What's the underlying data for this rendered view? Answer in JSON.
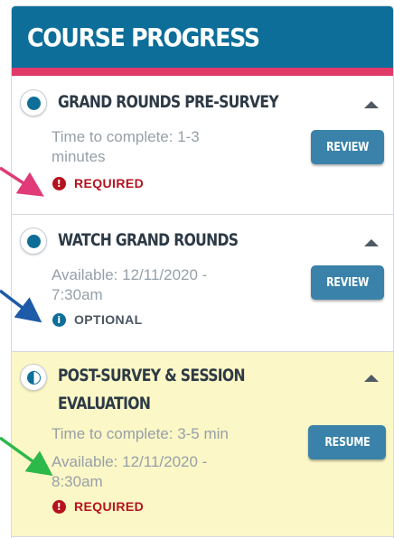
{
  "panel": {
    "title": "COURSE PROGRESS"
  },
  "items": [
    {
      "title": "GRAND ROUNDS PRE-SURVEY",
      "status": "complete",
      "meta_lines": [
        "Time to complete: 1-3",
        "minutes"
      ],
      "badge": "REQUIRED",
      "button": "REVIEW"
    },
    {
      "title": "WATCH GRAND ROUNDS",
      "status": "complete",
      "meta_lines": [
        "Available: 12/11/2020 -",
        "7:30am"
      ],
      "badge": "OPTIONAL",
      "button": "REVIEW"
    },
    {
      "title_lines": [
        "POST-SURVEY & SESSION",
        "EVALUATION"
      ],
      "status": "in-progress",
      "meta_lines": [
        "Time to complete: 3-5 min"
      ],
      "meta2_lines": [
        "Available: 12/11/2020 -",
        "8:30am"
      ],
      "badge": "REQUIRED",
      "button": "RESUME"
    }
  ],
  "icons": {
    "required": "!",
    "optional": "i"
  },
  "colors": {
    "header": "#0d6e99",
    "header_accent": "#e03a6b",
    "required": "#b5121e",
    "button": "#3a82a9",
    "highlight": "#fbf7c6",
    "arrow_pink": "#e03a78",
    "arrow_blue": "#1d5aa8",
    "arrow_green": "#2db84a"
  }
}
